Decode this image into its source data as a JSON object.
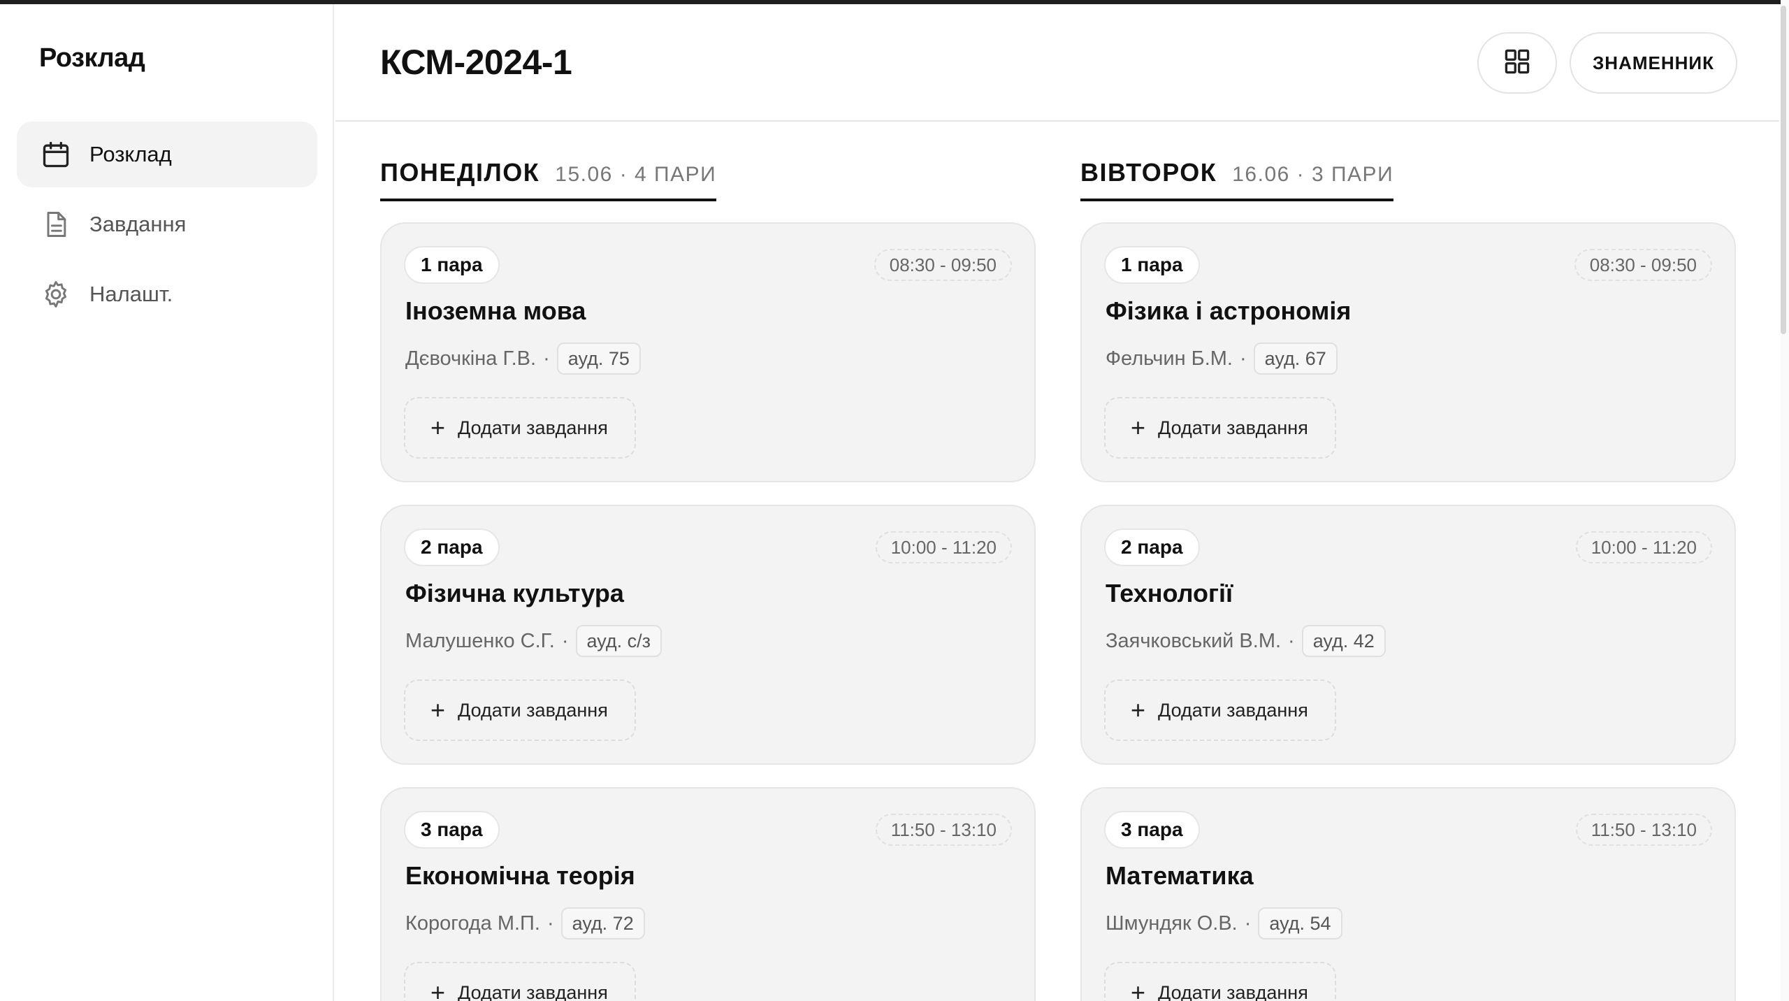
{
  "app": {
    "brand": "Розклад"
  },
  "sidebar": {
    "items": [
      {
        "label": "Розклад",
        "icon": "calendar-icon",
        "active": true
      },
      {
        "label": "Завдання",
        "icon": "document-icon",
        "active": false
      },
      {
        "label": "Налашт.",
        "icon": "gear-icon",
        "active": false
      }
    ]
  },
  "header": {
    "title": "КСМ-2024-1",
    "view_toggle_icon": "grid-icon",
    "week_button": "ЗНАМЕННИК"
  },
  "days": [
    {
      "name": "ПОНЕДІЛОК",
      "meta": "15.06 · 4 ПАРИ",
      "lessons": [
        {
          "pair": "1 пара",
          "time": "08:30 - 09:50",
          "subject": "Іноземна мова",
          "teacher": "Дєвочкіна Г.В.",
          "room": "ауд. 75",
          "add_task": "Додати завдання"
        },
        {
          "pair": "2 пара",
          "time": "10:00 - 11:20",
          "subject": "Фізична культура",
          "teacher": "Малушенко С.Г.",
          "room": "ауд. с/з",
          "add_task": "Додати завдання"
        },
        {
          "pair": "3 пара",
          "time": "11:50 - 13:10",
          "subject": "Економічна теорія",
          "teacher": "Корогода М.П.",
          "room": "ауд. 72",
          "add_task": "Додати завдання"
        }
      ]
    },
    {
      "name": "ВІВТОРОК",
      "meta": "16.06 · 3 ПАРИ",
      "lessons": [
        {
          "pair": "1 пара",
          "time": "08:30 - 09:50",
          "subject": "Фізика і астрономія",
          "teacher": "Фельчин Б.М.",
          "room": "ауд. 67",
          "add_task": "Додати завдання"
        },
        {
          "pair": "2 пара",
          "time": "10:00 - 11:20",
          "subject": "Технології",
          "teacher": "Заячковський В.М.",
          "room": "ауд. 42",
          "add_task": "Додати завдання"
        },
        {
          "pair": "3 пара",
          "time": "11:50 - 13:10",
          "subject": "Математика",
          "teacher": "Шмундяк О.В.",
          "room": "ауд. 54",
          "add_task": "Додати завдання"
        }
      ]
    }
  ],
  "colors": {
    "accent": "#111111",
    "card_bg": "#f3f3f3",
    "muted_text": "#666666",
    "border": "#e6e6e6"
  }
}
